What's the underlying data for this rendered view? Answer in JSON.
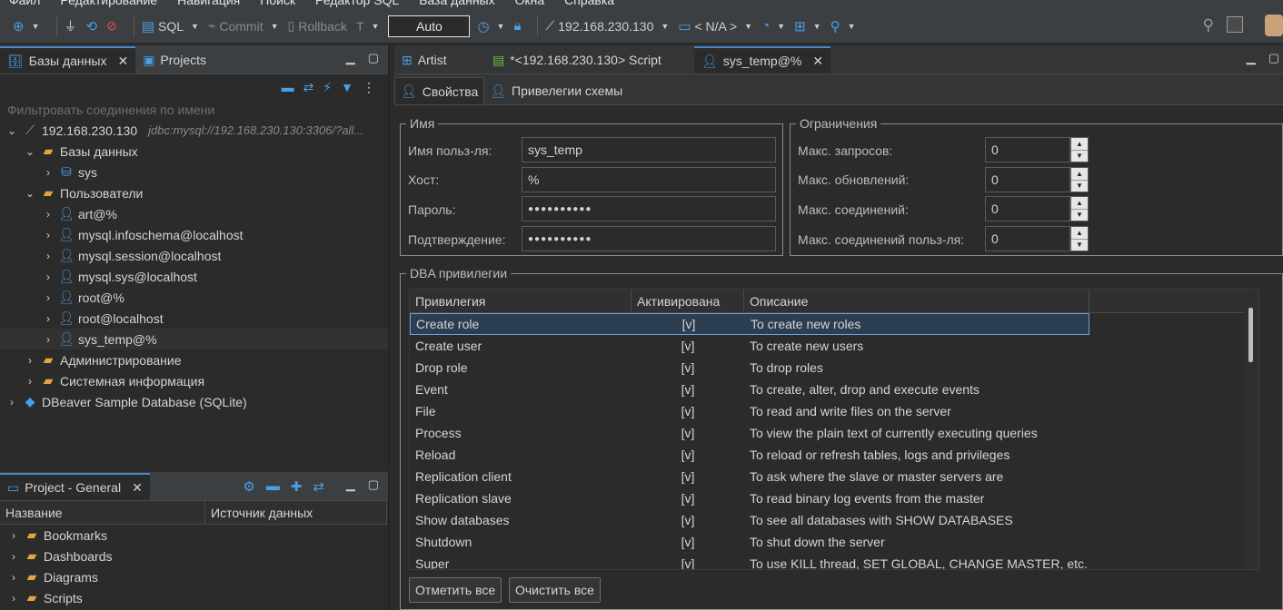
{
  "menu": [
    "Файл",
    "Редактирование",
    "Навигация",
    "Поиск",
    "Редактор SQL",
    "База данных",
    "Окна",
    "Справка"
  ],
  "toolbar": {
    "sql_label": "SQL",
    "commit_label": "Commit",
    "rollback_label": "Rollback",
    "auto_label": "Auto",
    "connection_label": "192.168.230.130",
    "schema_label": "< N/A >"
  },
  "navigator": {
    "tab_databases": "Базы данных",
    "tab_projects": "Projects",
    "filter_placeholder": "Фильтровать соединения по имени",
    "tree": {
      "conn_name": "192.168.230.130",
      "conn_url": "jdbc:mysql://192.168.230.130:3306/?all...",
      "databases": "Базы данных",
      "db_sys": "sys",
      "users": "Пользователи",
      "user_list": [
        "art@%",
        "mysql.infoschema@localhost",
        "mysql.session@localhost",
        "mysql.sys@localhost",
        "root@%",
        "root@localhost",
        "sys_temp@%"
      ],
      "admin": "Администрирование",
      "sysinfo": "Системная информация",
      "sample_db": "DBeaver Sample Database (SQLite)"
    }
  },
  "project": {
    "tab": "Project - General",
    "col_name": "Название",
    "col_source": "Источник данных",
    "items": [
      "Bookmarks",
      "Dashboards",
      "Diagrams",
      "Scripts"
    ]
  },
  "editor": {
    "tabs": [
      "Artist",
      "*<192.168.230.130> Script",
      "sys_temp@%"
    ],
    "subtab_props": "Свойства",
    "subtab_schema_priv": "Привелегии схемы",
    "name_group": {
      "legend": "Имя",
      "username_label": "Имя польз-ля:",
      "username_value": "sys_temp",
      "host_label": "Хост:",
      "host_value": "%",
      "password_label": "Пароль:",
      "password_value": "●●●●●●●●●●",
      "confirm_label": "Подтверждение:",
      "confirm_value": "●●●●●●●●●●"
    },
    "limits_group": {
      "legend": "Ограничения",
      "max_queries_label": "Макс. запросов:",
      "max_queries": "0",
      "max_updates_label": "Макс. обновлений:",
      "max_updates": "0",
      "max_conn_label": "Макс. соединений:",
      "max_conn": "0",
      "max_user_conn_label": "Макс. соединений польз-ля:",
      "max_user_conn": "0"
    },
    "dba": {
      "legend": "DBA привилегии",
      "col_privilege": "Привилегия",
      "col_enabled": "Активирована",
      "col_desc": "Описание",
      "rows": [
        {
          "name": "Create role",
          "enabled": "[v]",
          "desc": "To create new roles"
        },
        {
          "name": "Create user",
          "enabled": "[v]",
          "desc": "To create new users"
        },
        {
          "name": "Drop role",
          "enabled": "[v]",
          "desc": "To drop roles"
        },
        {
          "name": "Event",
          "enabled": "[v]",
          "desc": "To create, alter, drop and execute events"
        },
        {
          "name": "File",
          "enabled": "[v]",
          "desc": "To read and write files on the server"
        },
        {
          "name": "Process",
          "enabled": "[v]",
          "desc": "To view the plain text of currently executing queries"
        },
        {
          "name": "Reload",
          "enabled": "[v]",
          "desc": "To reload or refresh tables, logs and privileges"
        },
        {
          "name": "Replication client",
          "enabled": "[v]",
          "desc": "To ask where the slave or master servers are"
        },
        {
          "name": "Replication slave",
          "enabled": "[v]",
          "desc": "To read binary log events from the master"
        },
        {
          "name": "Show databases",
          "enabled": "[v]",
          "desc": "To see all databases with SHOW DATABASES"
        },
        {
          "name": "Shutdown",
          "enabled": "[v]",
          "desc": "To shut down the server"
        },
        {
          "name": "Super",
          "enabled": "[v]",
          "desc": "To use KILL thread, SET GLOBAL, CHANGE MASTER, etc."
        }
      ],
      "select_all": "Отметить все",
      "clear_all": "Очистить все"
    }
  }
}
